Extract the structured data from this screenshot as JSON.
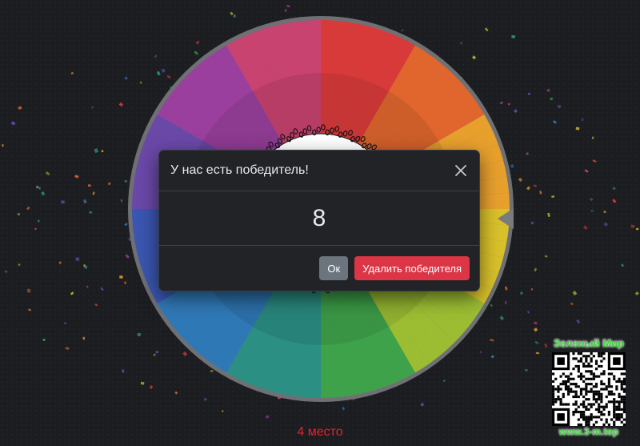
{
  "modal": {
    "title": "У нас есть победитель!",
    "winner": "8",
    "ok_label": "Ок",
    "remove_label": "Удалить победителя"
  },
  "place_label": "4 место",
  "watermark": {
    "title": "Зеленый Мир",
    "url": "www.3-m.top"
  },
  "colors": {
    "background": "#1c1d21",
    "modal_background": "#212327",
    "ok_button": "#6c757d",
    "remove_button": "#dc3545",
    "place_label": "#e8212a",
    "watermark_text": "#3dd13a",
    "wheel_rim": "#6f7074",
    "wheel_palette": [
      "#d83a3a",
      "#e0662d",
      "#e8a02d",
      "#d8c12a",
      "#9cbd32",
      "#3ea24a",
      "#2b8f84",
      "#2f78b6",
      "#3a56b0",
      "#6a48a8",
      "#9a3f9e",
      "#c8436f"
    ]
  },
  "icons": {
    "close": "close-icon",
    "pointer": "wheel-pointer-icon",
    "qr": "qr-code-icon"
  }
}
